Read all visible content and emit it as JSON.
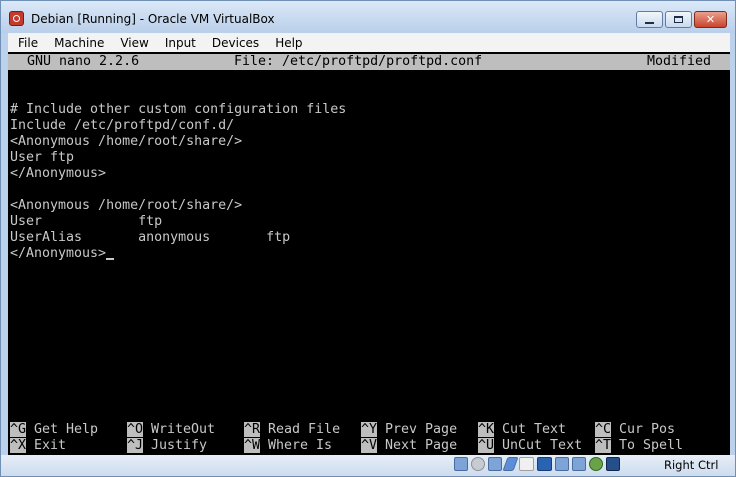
{
  "window": {
    "title": "Debian [Running] - Oracle VM VirtualBox",
    "controls": [
      "minimize-icon",
      "maximize-icon",
      "close-icon"
    ],
    "close_glyph": "✕"
  },
  "menubar": {
    "items": [
      "File",
      "Machine",
      "View",
      "Input",
      "Devices",
      "Help"
    ]
  },
  "nano": {
    "version": "GNU nano 2.2.6",
    "file": "File: /etc/proftpd/proftpd.conf",
    "status": "Modified",
    "lines": [
      "",
      "",
      "# Include other custom configuration files",
      "Include /etc/proftpd/conf.d/",
      "<Anonymous /home/root/share/>",
      "User ftp",
      "</Anonymous>",
      "",
      "<Anonymous /home/root/share/>",
      "User            ftp",
      "UserAlias       anonymous       ftp",
      "</Anonymous>"
    ],
    "cursor_line": 11,
    "shortcuts": [
      [
        {
          "key": "^G",
          "label": " Get Help"
        },
        {
          "key": "^O",
          "label": " WriteOut"
        },
        {
          "key": "^R",
          "label": " Read File"
        },
        {
          "key": "^Y",
          "label": " Prev Page"
        },
        {
          "key": "^K",
          "label": " Cut Text"
        },
        {
          "key": "^C",
          "label": " Cur Pos"
        }
      ],
      [
        {
          "key": "^X",
          "label": " Exit"
        },
        {
          "key": "^J",
          "label": " Justify"
        },
        {
          "key": "^W",
          "label": " Where Is"
        },
        {
          "key": "^V",
          "label": " Next Page"
        },
        {
          "key": "^U",
          "label": " UnCut Text"
        },
        {
          "key": "^T",
          "label": " To Spell"
        }
      ]
    ]
  },
  "statusbar": {
    "icons": [
      "hard-disk-icon",
      "optical-disk-icon",
      "network-icon",
      "usb-icon",
      "shared-folders-icon",
      "display-icon",
      "video-capture-icon",
      "virtualization-icon",
      "mouse-integration-icon",
      "host-key-arrow-icon"
    ],
    "host_key": "Right Ctrl"
  },
  "colors": {
    "terminal_bg": "#000000",
    "terminal_fg": "#c8c8c8",
    "nano_bar_bg": "#bebebe",
    "chrome": "#bcd2ec",
    "close_button": "#c9442c"
  }
}
